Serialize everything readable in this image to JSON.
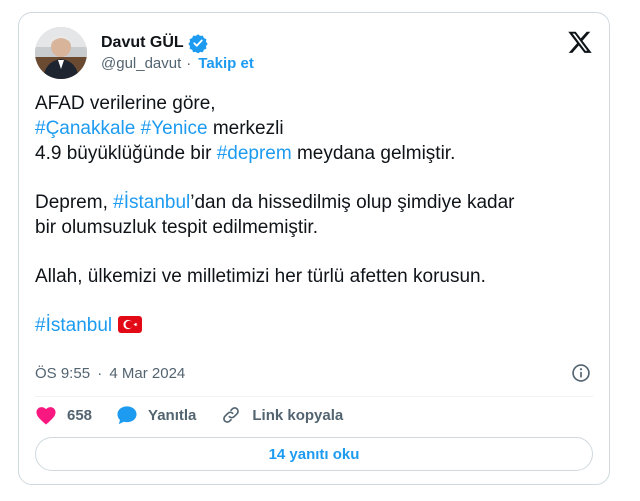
{
  "author": {
    "name": "Davut GÜL",
    "handle": "@gul_davut",
    "separator": "·",
    "follow_label": "Takip et"
  },
  "tweet": {
    "line1": "AFAD verilerine göre,",
    "line2_tag1": "#Çanakkale",
    "line2_tag2": "#Yenice",
    "line2_text": " merkezli",
    "line3_text1": "4.9 büyüklüğünde bir ",
    "line3_tag": "#deprem",
    "line3_text2": " meydana gelmiştir.",
    "para2_text1": "Deprem, ",
    "para2_tag": "#İstanbul",
    "para2_text2": "’dan da hissedilmiş olup şimdiye kadar",
    "para2_line2": "bir olumsuzluk tespit edilmemiştir.",
    "para3": "Allah, ülkemizi ve milletimizi her türlü afetten korusun.",
    "final_tag": "#İstanbul",
    "flag_icon": "turkey-flag"
  },
  "meta": {
    "time": "ÖS 9:55",
    "separator": "·",
    "date": "4 Mar 2024"
  },
  "actions": {
    "like_count": "658",
    "reply_label": "Yanıtla",
    "copy_link_label": "Link kopyala"
  },
  "read_replies_label": "14 yanıtı oku",
  "colors": {
    "accent": "#1d9bf0",
    "like": "#f91880",
    "flag": "#e30a17"
  }
}
